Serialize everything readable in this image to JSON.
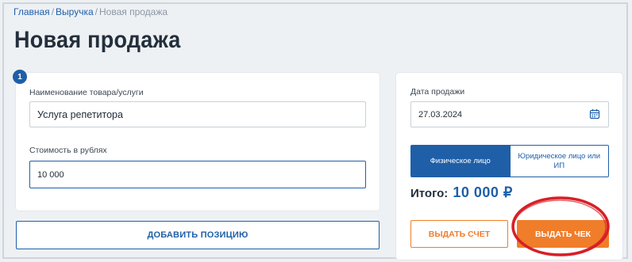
{
  "breadcrumb": {
    "home": "Главная",
    "revenue": "Выручка",
    "current": "Новая продажа",
    "separator": "/"
  },
  "page": {
    "title": "Новая продажа"
  },
  "item_card": {
    "step": "1",
    "name_label": "Наименование товара/услуги",
    "name_value": "Услуга репетитора",
    "price_label": "Стоимость в рублях",
    "price_value": "10 000"
  },
  "add_position_label": "ДОБАВИТЬ ПОЗИЦИЮ",
  "sale": {
    "date_label": "Дата продажи",
    "date_value": "27.03.2024",
    "date_icon": "calendar-icon",
    "buyer_types": [
      {
        "label": "Физическое лицо",
        "selected": true
      },
      {
        "label": "Юридическое лицо или ИП",
        "selected": false
      }
    ],
    "total_label": "Итого:",
    "total_value": "10 000 ₽",
    "issue_account_label": "ВЫДАТЬ СЧЕТ",
    "issue_receipt_label": "ВЫДАТЬ ЧЕК"
  },
  "colors": {
    "accent": "#1f5fa8",
    "orange": "#f07d2a",
    "highlight": "#d81f26"
  }
}
